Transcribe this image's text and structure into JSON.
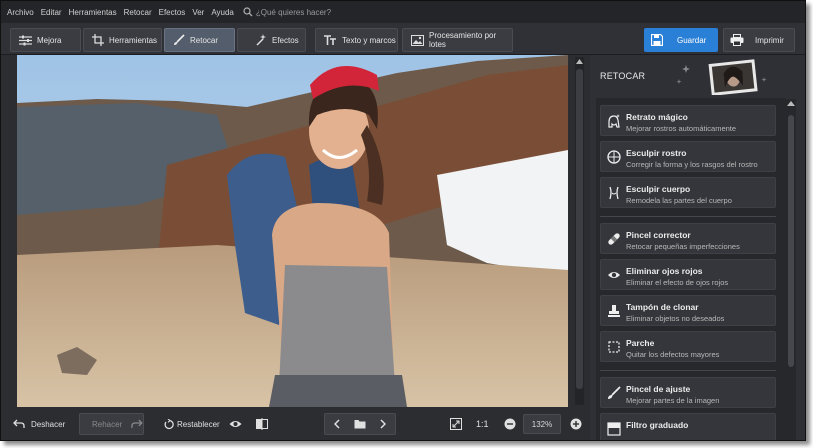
{
  "menu": {
    "items": [
      "Archivo",
      "Editar",
      "Herramientas",
      "Retocar",
      "Efectos",
      "Ver",
      "Ayuda"
    ],
    "search_placeholder": "¿Qué quieres hacer?"
  },
  "toolbar": {
    "tabs": [
      {
        "label": "Mejora",
        "icon": "sliders-icon"
      },
      {
        "label": "Herramientas",
        "icon": "crop-icon"
      },
      {
        "label": "Retocar",
        "icon": "brush-icon",
        "active": true
      },
      {
        "label": "Efectos",
        "icon": "magic-wand-icon"
      },
      {
        "label": "Texto y marcos",
        "icon": "text-icon"
      },
      {
        "label": "Procesamiento por lotes",
        "icon": "images-icon"
      }
    ],
    "save_label": "Guardar",
    "print_label": "Imprimir",
    "accent_color": "#2a7fd6"
  },
  "panel": {
    "title": "RETOCAR",
    "tools": [
      {
        "name": "Retrato mágico",
        "desc": "Mejorar rostros automáticamente",
        "icon": "magic-portrait-icon"
      },
      {
        "name": "Esculpir rostro",
        "desc": "Corregir la forma y los rasgos del rostro",
        "icon": "face-sculpt-icon"
      },
      {
        "name": "Esculpir cuerpo",
        "desc": "Remodela las partes del cuerpo",
        "icon": "body-sculpt-icon"
      },
      {
        "name": "Pincel corrector",
        "desc": "Retocar pequeñas imperfecciones",
        "icon": "bandage-icon"
      },
      {
        "name": "Eliminar ojos rojos",
        "desc": "Eliminar el efecto de ojos rojos",
        "icon": "eye-icon"
      },
      {
        "name": "Tampón de clonar",
        "desc": "Eliminar objetos no deseados",
        "icon": "stamp-icon"
      },
      {
        "name": "Parche",
        "desc": "Quitar los defectos mayores",
        "icon": "patch-icon"
      },
      {
        "name": "Pincel de ajuste",
        "desc": "Mejorar partes de la imagen",
        "icon": "adjust-brush-icon"
      },
      {
        "name": "Filtro graduado",
        "desc": "",
        "icon": "gradient-filter-icon"
      }
    ]
  },
  "bottom": {
    "undo_label": "Deshacer",
    "redo_label": "Rehacer",
    "reset_label": "Restablecer",
    "zoom_ratio_label": "1:1",
    "zoom_value": "132%"
  }
}
